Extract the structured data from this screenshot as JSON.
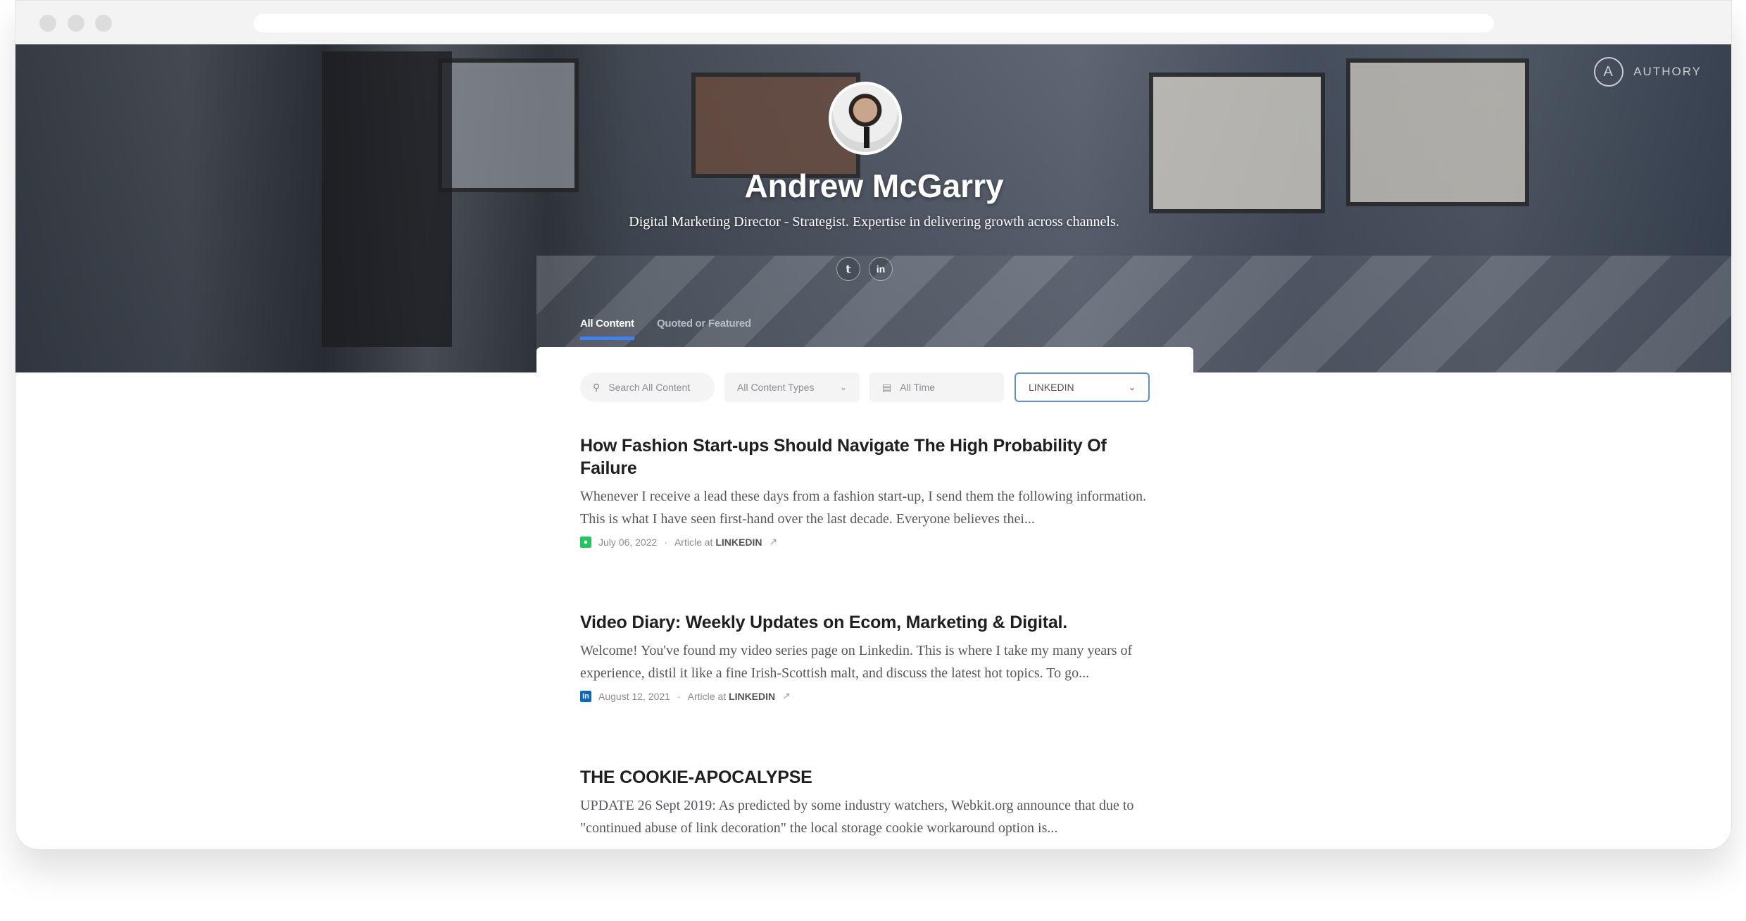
{
  "brand": {
    "name": "AUTHORY",
    "logo_letter": "A"
  },
  "profile": {
    "name": "Andrew McGarry",
    "tagline": "Digital Marketing Director - Strategist. Expertise in delivering growth across channels.",
    "social": [
      {
        "icon": "twitter-icon",
        "label": "t"
      },
      {
        "icon": "linkedin-icon",
        "label": "in"
      }
    ]
  },
  "tabs": [
    {
      "label": "All Content",
      "active": true
    },
    {
      "label": "Quoted or Featured",
      "active": false
    }
  ],
  "filters": {
    "search_placeholder": "Search All Content",
    "content_type": "All Content Types",
    "time": "All Time",
    "source": "LINKEDIN",
    "accent": "#3b82f6"
  },
  "articles": [
    {
      "title": "How Fashion Start-ups Should Navigate The High Probability Of Failure",
      "excerpt": "Whenever I receive a lead these days from a fashion start-up, I send them the following information. This is what I have seen first-hand over the last decade. Everyone believes thei...",
      "date": "July 06, 2022",
      "type": "Article at",
      "source": "LINKEDIN",
      "source_icon_color": "#22c55e"
    },
    {
      "title": "Video Diary: Weekly Updates on Ecom, Marketing & Digital.",
      "excerpt": "Welcome! You've found my video series page on Linkedin. This is where I take my many years of experience, distil it like a fine Irish-Scottish malt, and discuss the latest hot topics. To go...",
      "date": "August 12, 2021",
      "type": "Article at",
      "source": "LINKEDIN",
      "source_icon_color": "#0a66c2"
    },
    {
      "title": "THE COOKIE-APOCALYPSE",
      "excerpt": "UPDATE 26 Sept 2019: As predicted by some industry watchers, Webkit.org announce that due to \"continued abuse of link decoration\" the local storage cookie workaround option is..."
    }
  ]
}
